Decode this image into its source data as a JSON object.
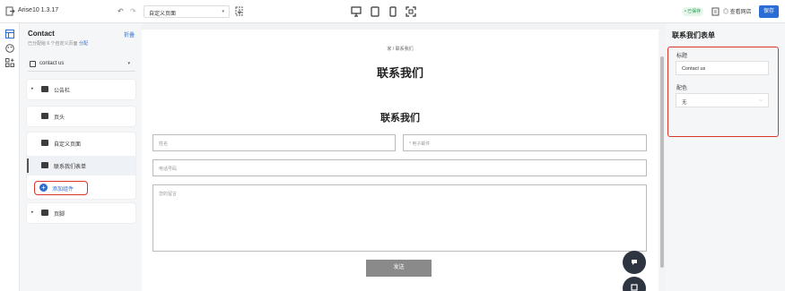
{
  "topbar": {
    "title": "Arise10 1.3.17",
    "undo": "↶",
    "redo": "↷",
    "page_select_value": "自定义页面",
    "page_select_caret": "▾",
    "status": "• 已保存",
    "preview_label": "◎ 查看网店",
    "save_label": "保存",
    "accent": "#2b6cd6"
  },
  "left_panel": {
    "title": "Contact",
    "edit_label": "折叠",
    "note": "已分配给 6 个自定义页面",
    "note_link": "分配",
    "layout_select": "contact us",
    "layout_caret": "▾",
    "sections": [
      {
        "label": "公告栏",
        "chevron": "▸"
      },
      {
        "label": "页头"
      },
      {
        "label": "自定义页面"
      },
      {
        "label": "联系我们表单"
      },
      {
        "label": "页脚",
        "chevron": "▸"
      }
    ],
    "add_section": {
      "icon": "+",
      "label": "添加组件"
    }
  },
  "canvas": {
    "breadcrumb": "家  /  联系我们",
    "page_heading": "联系我们",
    "form_heading": "联系我们",
    "name_placeholder": "姓名",
    "email_placeholder": "* 电子邮件",
    "phone_placeholder": "电话号码",
    "message_placeholder": "您的留言",
    "send_label": "发送"
  },
  "right_panel": {
    "title": "联系我们表单",
    "heading_label": "标题",
    "heading_value": "Contact us",
    "color_label": "配色",
    "color_value": "无",
    "color_caret": "⌵",
    "highlight": "#d9362b"
  }
}
